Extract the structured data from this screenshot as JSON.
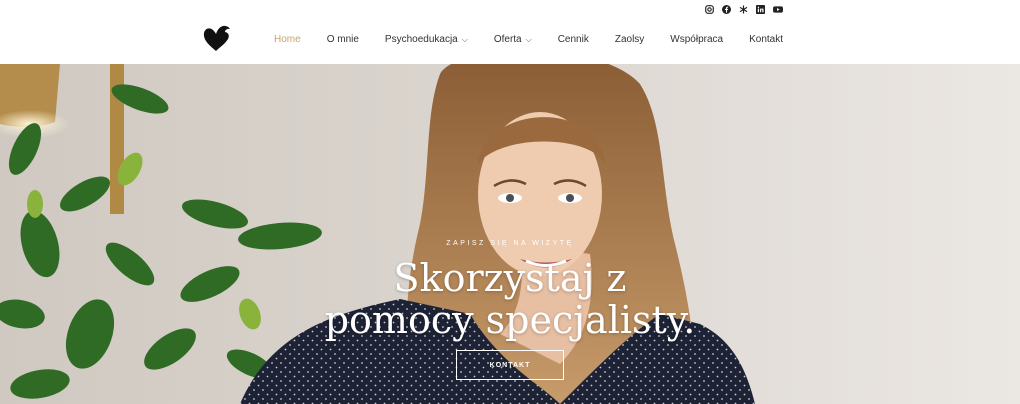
{
  "social": [
    "instagram-icon",
    "facebook-icon",
    "snowflake-icon",
    "linkedin-icon",
    "youtube-icon"
  ],
  "nav": {
    "items": [
      {
        "label": "Home",
        "active": true,
        "dropdown": false
      },
      {
        "label": "O mnie",
        "active": false,
        "dropdown": false
      },
      {
        "label": "Psychoedukacja",
        "active": false,
        "dropdown": true
      },
      {
        "label": "Oferta",
        "active": false,
        "dropdown": true
      },
      {
        "label": "Cennik",
        "active": false,
        "dropdown": false
      },
      {
        "label": "Zaolsy",
        "active": false,
        "dropdown": false
      },
      {
        "label": "Współpraca",
        "active": false,
        "dropdown": false
      },
      {
        "label": "Kontakt",
        "active": false,
        "dropdown": false
      }
    ]
  },
  "hero": {
    "eyebrow": "ZAPISZ SIĘ NA WIZYTĘ",
    "headline_line1": "Skorzystaj z",
    "headline_line2": "pomocy specjalisty.",
    "cta": "KONTAKT"
  },
  "colors": {
    "accent": "#c9a26b",
    "text": "#333333"
  }
}
